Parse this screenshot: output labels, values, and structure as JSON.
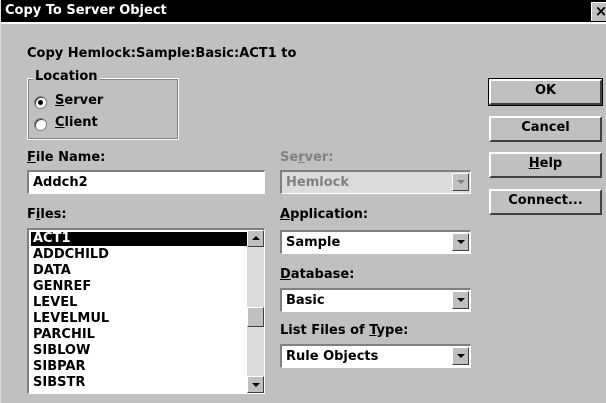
{
  "window": {
    "title": "Copy To Server Object",
    "close_glyph": "×"
  },
  "header": {
    "copy_text": "Copy Hemlock:Sample:Basic:ACT1 to"
  },
  "location": {
    "label": "Location",
    "options": [
      {
        "label": "Server",
        "selected": true
      },
      {
        "label": "Client",
        "selected": false
      }
    ]
  },
  "file_name": {
    "label": "File Name:",
    "value": "Addch2"
  },
  "files": {
    "label": "Files:",
    "items": [
      "ACT1",
      "ADDCHILD",
      "DATA",
      "GENREF",
      "LEVEL",
      "LEVELMUL",
      "PARCHIL",
      "SIBLOW",
      "SIBPAR",
      "SIBSTR"
    ],
    "selected_index": 0,
    "scroll_position": 0.55
  },
  "server": {
    "label": "Server:",
    "value": "Hemlock",
    "enabled": false
  },
  "application": {
    "label": "Application:",
    "value": "Sample"
  },
  "database": {
    "label": "Database:",
    "value": "Basic"
  },
  "list_type": {
    "label": "List Files of Type:",
    "value": "Rule Objects"
  },
  "buttons": {
    "ok": "OK",
    "cancel": "Cancel",
    "help": "Help",
    "connect": "Connect..."
  },
  "colors": {
    "face": "#c0c0c0",
    "title_bar": "#000000",
    "selection": "#000000"
  }
}
